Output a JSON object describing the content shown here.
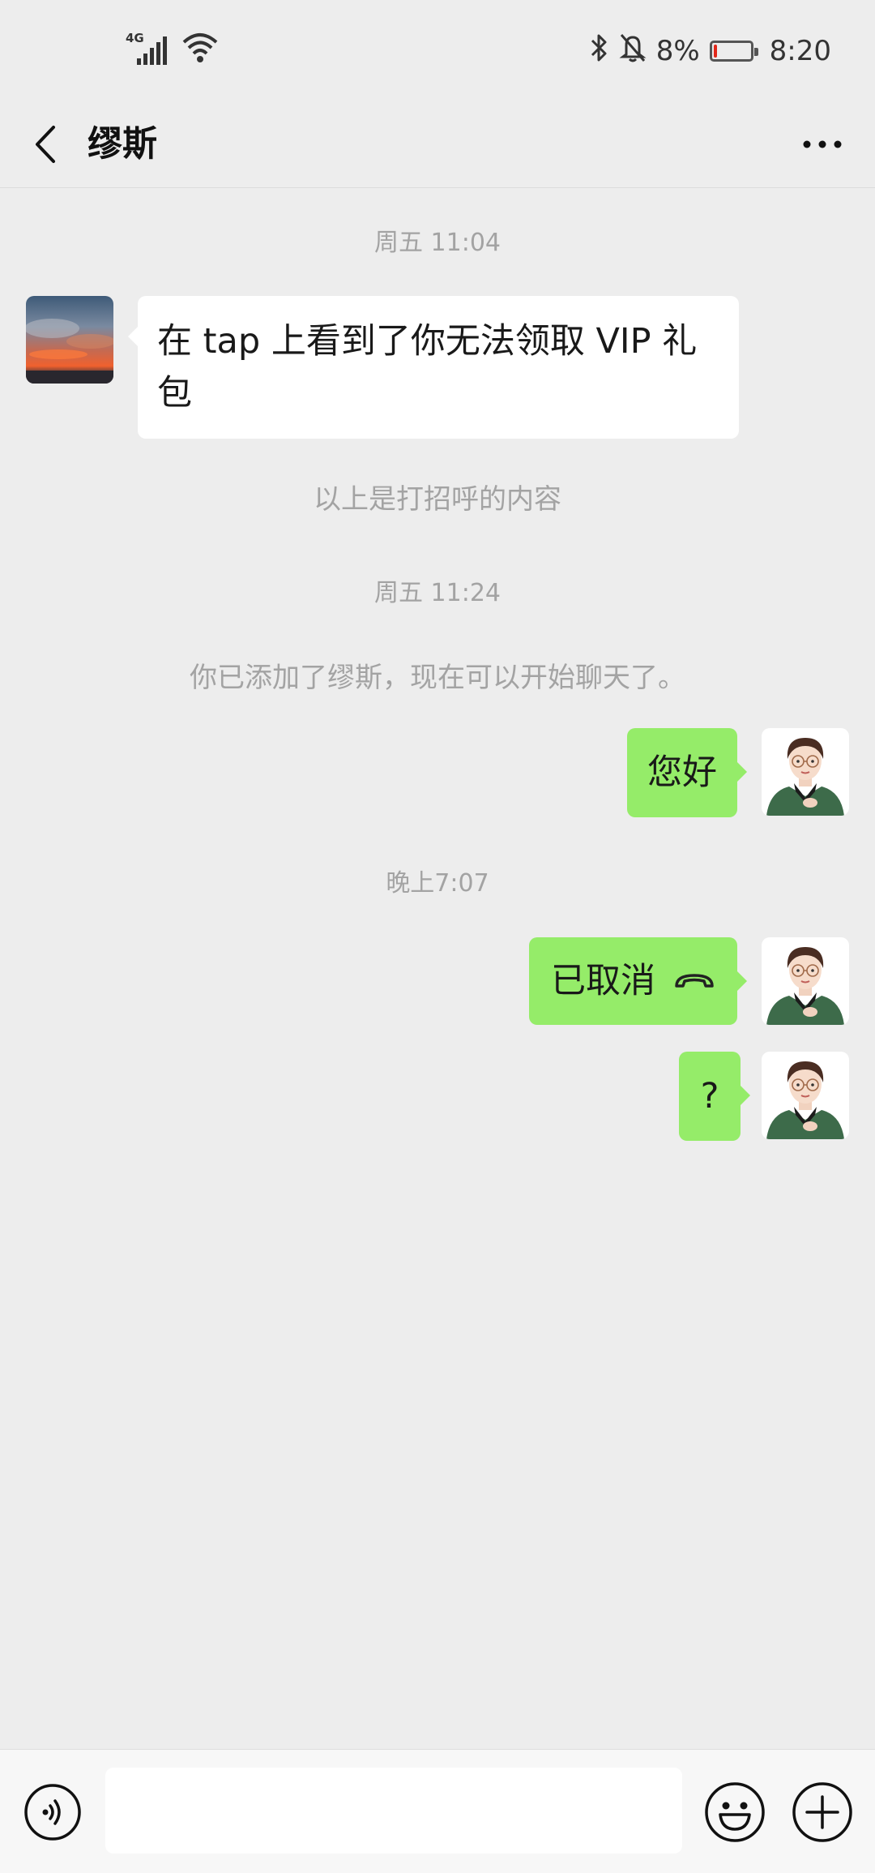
{
  "status_bar": {
    "network": "4G",
    "battery_percent_text": "8%",
    "battery_level": 0.08,
    "time": "8:20",
    "icons": [
      "signal-icon",
      "wifi-icon",
      "bluetooth-icon",
      "bell-muted-icon",
      "battery-icon"
    ]
  },
  "header": {
    "title": "缪斯",
    "back_icon": "chevron-left-icon",
    "more_icon": "more-dots-icon"
  },
  "chat": {
    "timestamp_1": "周五 11:04",
    "incoming_message": "在 tap 上看到了你无法领取 VIP 礼包",
    "greeting_note": "以上是打招呼的内容",
    "timestamp_2": "周五 11:24",
    "added_note": "你已添加了缪斯，现在可以开始聊天了。",
    "outgoing_1": "您好",
    "timestamp_3": "晚上7:07",
    "call_status": "已取消",
    "call_icon": "phone-hangup-icon",
    "outgoing_2": "?"
  },
  "input_bar": {
    "message_value": "",
    "voice_icon": "voice-icon",
    "emoji_icon": "emoji-icon",
    "plus_icon": "plus-circle-icon"
  },
  "colors": {
    "background": "#ededed",
    "outgoing_bubble": "#95ec69",
    "incoming_bubble": "#ffffff",
    "meta_text": "#a3a3a3",
    "battery_low": "#e2271a"
  }
}
